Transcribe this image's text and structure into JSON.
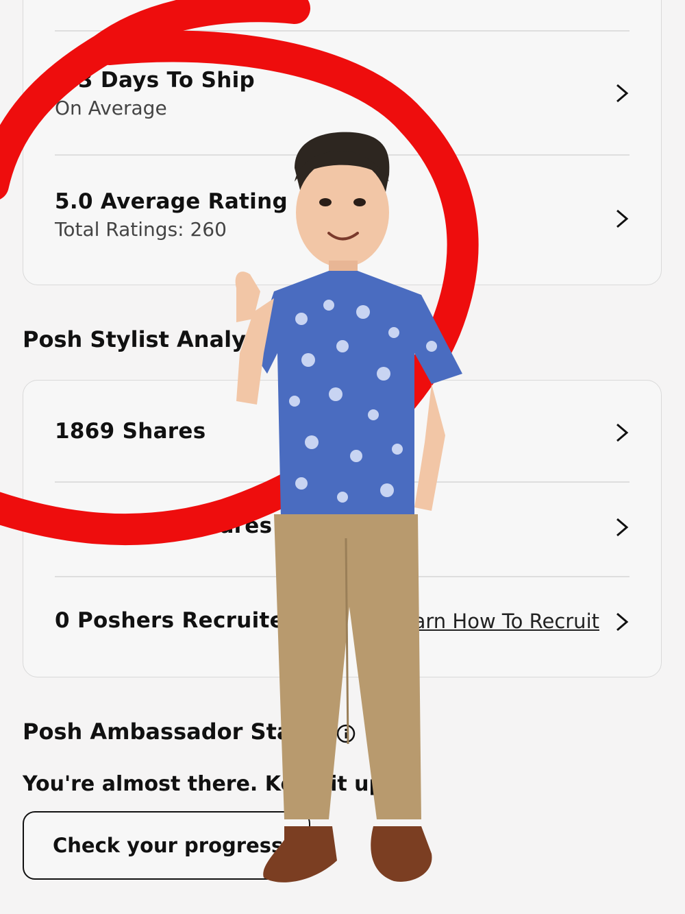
{
  "seller_stats": {
    "ship_days": {
      "title": "1.3 Days To Ship",
      "subtitle": "On Average"
    },
    "rating": {
      "title": "5.0 Average Rating",
      "subtitle": "Total Ratings: 260"
    }
  },
  "stylist_section": {
    "title": "Posh Stylist Analytics",
    "rows": [
      {
        "title": "1869 Shares"
      },
      {
        "title": "271 Direct Shares"
      },
      {
        "title": "0 Poshers Recruited",
        "link": "Learn How To Recruit"
      }
    ]
  },
  "ambassador_section": {
    "title": "Posh Ambassador Status",
    "message": "You're almost there. Keep it up!",
    "button_label": "Check your progress"
  },
  "icons": [
    "chevron-right-icon",
    "info-icon"
  ],
  "colors": {
    "annotation_red": "#ee0d0d",
    "background": "#f5f4f4"
  }
}
